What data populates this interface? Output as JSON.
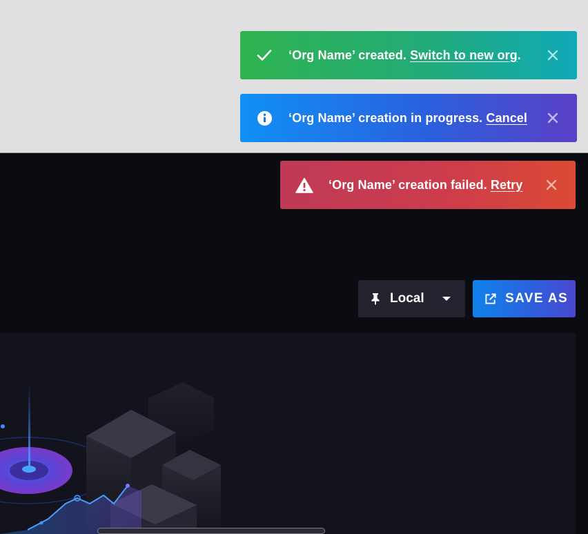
{
  "toasts": {
    "success": {
      "icon": "check-icon",
      "message": "‘Org Name’ created. ",
      "action": "Switch to new org",
      "suffix": ".",
      "close_icon": "close-icon"
    },
    "info": {
      "icon": "info-icon",
      "message": "‘Org Name’ creation in progress. ",
      "action": "Cancel",
      "close_icon": "close-icon"
    },
    "error": {
      "icon": "warning-icon",
      "message": "‘Org Name’ creation failed. ",
      "action": "Retry",
      "close_icon": "close-icon"
    }
  },
  "toolbar": {
    "scope_select": {
      "icon": "pin-icon",
      "value": "Local",
      "caret_icon": "caret-down-icon"
    },
    "save_as": {
      "icon": "external-link-icon",
      "label": "SAVE AS"
    }
  },
  "colors": {
    "success_gradient": [
      "#2fb34f",
      "#0fa9b8"
    ],
    "info_gradient": [
      "#1090f6",
      "#5a3fc6"
    ],
    "error_gradient": [
      "#bf3a56",
      "#db4a33"
    ],
    "primary_button_gradient": [
      "#0f82ec",
      "#4a48cf"
    ],
    "background_dark": "#0b0c12",
    "panel": "#12131c"
  }
}
